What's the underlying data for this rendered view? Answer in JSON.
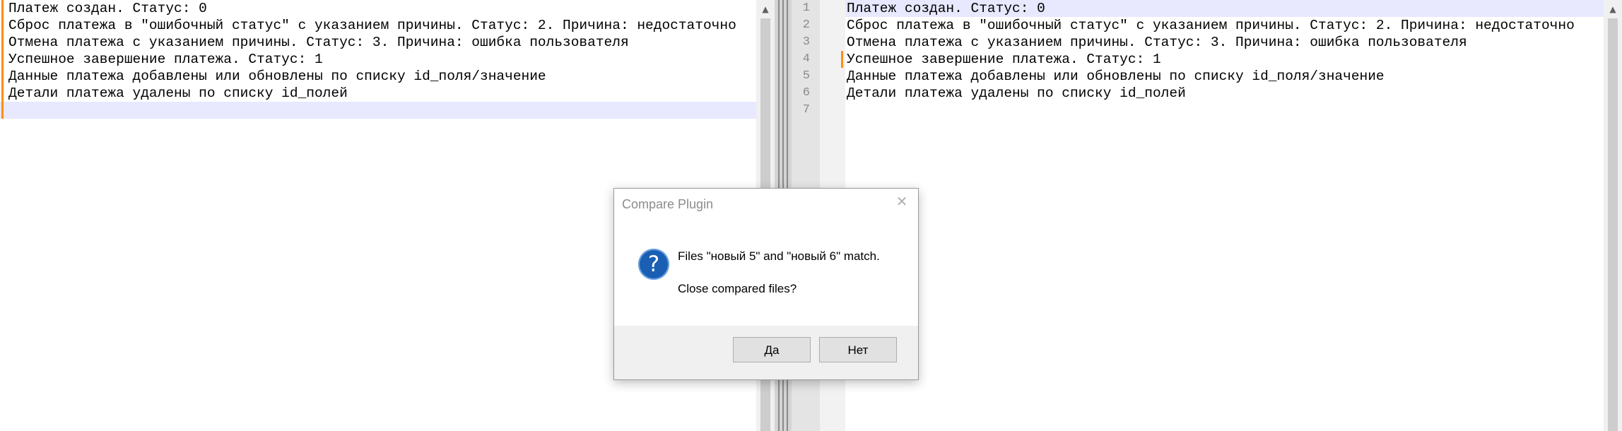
{
  "left_editor": {
    "lines": [
      "Платеж создан. Статус: 0",
      "Сброс платежа в \"ошибочный статус\" с указанием причины. Статус: 2. Причина: недостаточно",
      "Отмена платежа с указанием причины. Статус: 3. Причина: ошибка пользователя",
      "Успешное завершение платежа. Статус: 1",
      "Данные платежа добавлены или обновлены по списку id_поля/значение",
      "Детали платежа удалены по списку id_полей",
      ""
    ]
  },
  "right_editor": {
    "line_numbers": [
      "1",
      "2",
      "3",
      "4",
      "5",
      "6",
      "7"
    ],
    "lines": [
      "Платеж создан. Статус: 0",
      "Сброс платежа в \"ошибочный статус\" с указанием причины. Статус: 2. Причина: недостаточно",
      "Отмена платежа с указанием причины. Статус: 3. Причина: ошибка пользователя",
      "Успешное завершение платежа. Статус: 1",
      "Данные платежа добавлены или обновлены по списку id_поля/значение",
      "Детали платежа удалены по списку id_полей",
      ""
    ]
  },
  "scrollbar": {
    "up_arrow": "▲"
  },
  "dialog": {
    "title": "Compare Plugin",
    "close_glyph": "✕",
    "icon_glyph": "?",
    "message_line1": "Files \"новый 5\" and \"новый 6\" match.",
    "message_line2": "Close compared files?",
    "yes_label": "Да",
    "no_label": "Нет"
  },
  "icons": {
    "dialog": "question-icon",
    "scroll": "chevron-up-icon",
    "close": "close-icon"
  },
  "colors": {
    "highlight": "#e8e8ff",
    "change_marker": "#ff8c1a",
    "question_icon": "#1a5fb4"
  }
}
